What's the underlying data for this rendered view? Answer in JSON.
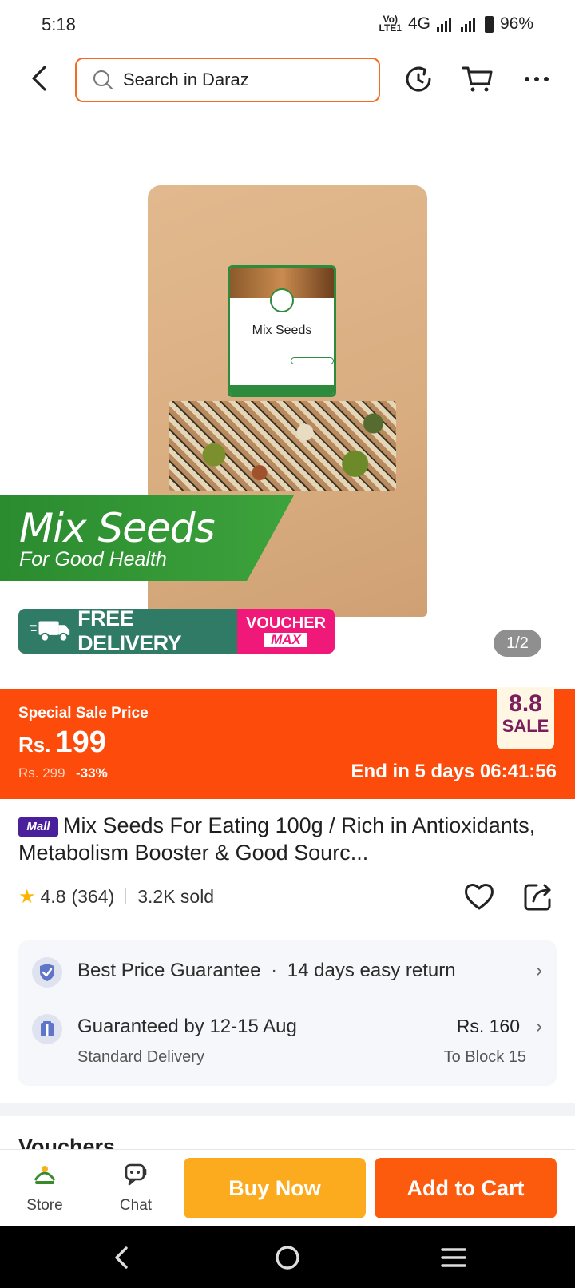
{
  "status_bar": {
    "time": "5:18",
    "network_top": "Vo)",
    "network_bottom": "LTE1",
    "network_type": "4G",
    "battery": "96%"
  },
  "header": {
    "search_placeholder": "Search in Daraz",
    "icons": [
      "back-arrow-icon",
      "search-icon",
      "history-icon",
      "cart-icon",
      "more-icon"
    ],
    "accent_color": "#f36c21"
  },
  "gallery": {
    "package_label": "Mix Seeds",
    "promo_title": "Mix Seeds",
    "promo_subtitle": "For Good Health",
    "free_delivery": "FREE DELIVERY",
    "voucher_top": "VOUCHER",
    "voucher_bottom": "MAX",
    "counter": "1/2"
  },
  "sale": {
    "label": "Special Sale Price",
    "currency": "Rs.",
    "price": "199",
    "old_price": "Rs. 299",
    "discount": "-33%",
    "timer": "End in 5 days 06:41:56",
    "tag_number": "8.8",
    "tag_word": "SALE",
    "band_color": "#fc4b0a"
  },
  "product": {
    "mall_badge": "Mall",
    "title": "Mix Seeds For Eating 100g / Rich in Antioxidants, Metabolism Booster & Good Sourc...",
    "rating": "4.8",
    "reviews": "(364)",
    "sold": "3.2K sold"
  },
  "service": {
    "guarantee": "Best Price Guarantee",
    "dot": "·",
    "returns": "14 days easy return",
    "delivery_title": "Guaranteed by 12-15 Aug",
    "delivery_sub": "Standard Delivery",
    "delivery_price": "Rs. 160",
    "delivery_location": "To Block 15"
  },
  "next_section": {
    "title": "Vouchers"
  },
  "action_bar": {
    "store_label": "Store",
    "chat_label": "Chat",
    "buy_now": "Buy Now",
    "add_to_cart": "Add to Cart",
    "buy_color": "#fcaa1e",
    "cart_color": "#fc5a0d"
  }
}
